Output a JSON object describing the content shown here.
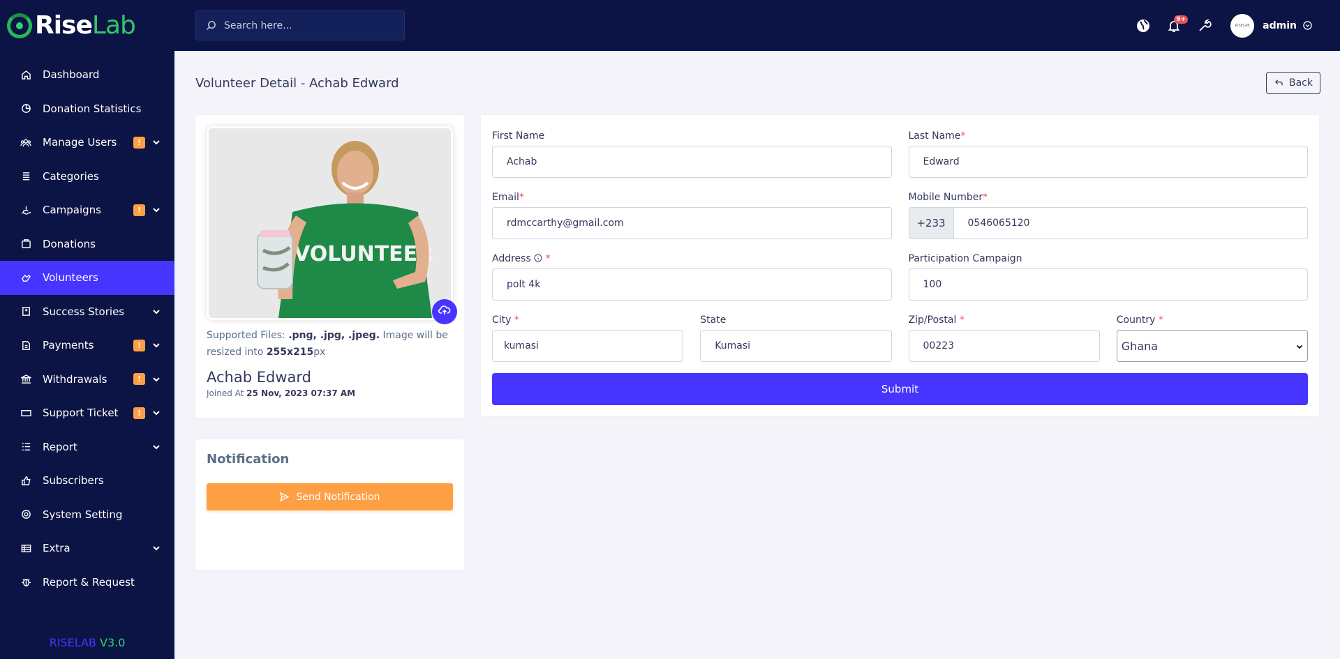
{
  "brand": {
    "rise": "Rise",
    "lab": "Lab"
  },
  "sidebar": {
    "items": [
      {
        "label": "Dashboard",
        "icon": "home-icon"
      },
      {
        "label": "Donation Statistics",
        "icon": "pie-chart-icon"
      },
      {
        "label": "Manage Users",
        "icon": "users-icon",
        "warn": "!",
        "chevron": true
      },
      {
        "label": "Categories",
        "icon": "list-icon"
      },
      {
        "label": "Campaigns",
        "icon": "hand-icon",
        "warn": "!",
        "chevron": true
      },
      {
        "label": "Donations",
        "icon": "donation-icon"
      },
      {
        "label": "Volunteers",
        "icon": "volunteer-icon",
        "active": true
      },
      {
        "label": "Success Stories",
        "icon": "book-icon",
        "chevron": true
      },
      {
        "label": "Payments",
        "icon": "payment-icon",
        "warn": "!",
        "chevron": true
      },
      {
        "label": "Withdrawals",
        "icon": "bank-icon",
        "warn": "!",
        "chevron": true
      },
      {
        "label": "Support Ticket",
        "icon": "ticket-icon",
        "warn": "!",
        "chevron": true
      },
      {
        "label": "Report",
        "icon": "report-icon",
        "chevron": true
      },
      {
        "label": "Subscribers",
        "icon": "thumbs-up-icon"
      },
      {
        "label": "System Setting",
        "icon": "lifebuoy-icon"
      },
      {
        "label": "Extra",
        "icon": "server-icon",
        "chevron": true
      },
      {
        "label": "Report & Request",
        "icon": "bug-icon"
      }
    ],
    "version_name": "RISELAB",
    "version_num": "V3.0"
  },
  "header": {
    "search_placeholder": "Search here...",
    "notification_count": "9+",
    "avatar_text": "RISELAB",
    "user_name": "admin"
  },
  "page": {
    "title": "Volunteer Detail - Achab Edward",
    "back_label": "Back"
  },
  "profile": {
    "supported_prefix": "Supported Files: ",
    "supported_types": ".png, .jpg, .jpeg.",
    "supported_mid": " Image will be resized into ",
    "supported_size": "255x215",
    "supported_unit": "px",
    "photo_shirt_text": "VOLUNTEER",
    "name": "Achab Edward",
    "joined_label": "Joined At ",
    "joined_date": "25 Nov, 2023 07:37 AM"
  },
  "notification": {
    "title": "Notification",
    "button_label": "Send Notification"
  },
  "form": {
    "first_name_label": "First Name",
    "first_name": "Achab",
    "last_name_label": "Last Name",
    "last_name": "Edward",
    "email_label": "Email",
    "email": "rdmccarthy@gmail.com",
    "mobile_label": "Mobile Number",
    "mobile_code": "+233",
    "mobile": "0546065120",
    "address_label": "Address",
    "address": "polt 4k",
    "campaign_label": "Participation Campaign",
    "campaign": "100",
    "city_label": "City",
    "city": "kumasi",
    "state_label": "State",
    "state": "Kumasi",
    "zip_label": "Zip/Postal",
    "zip": "00223",
    "country_label": "Country",
    "country": "Ghana",
    "submit_label": "Submit",
    "required_mark": "*"
  },
  "colors": {
    "sidebar_bg": "#0c1445",
    "primary": "#4634ff",
    "warning": "#ff9f43",
    "brand_green": "#33c66a",
    "danger": "#ea5455"
  }
}
